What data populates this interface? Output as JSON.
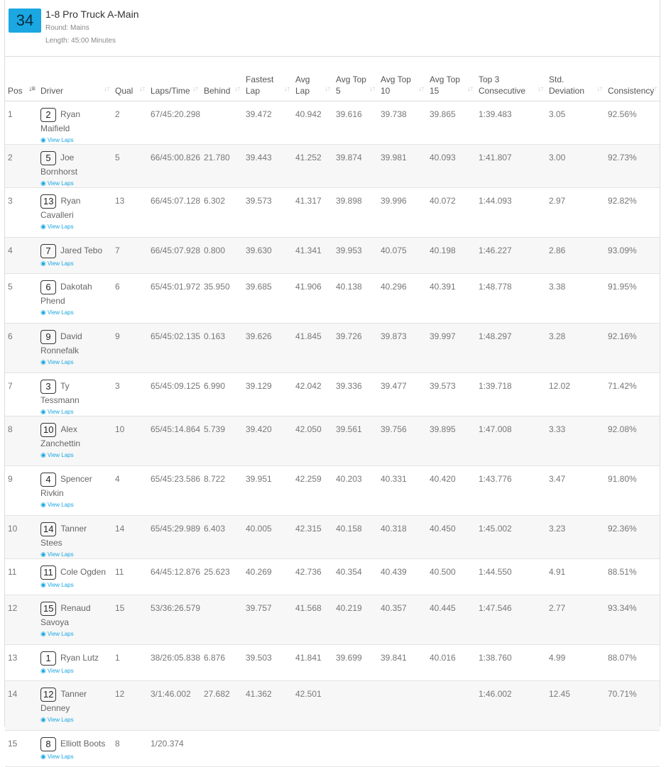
{
  "race": {
    "number": "34",
    "title": "1-8 Pro Truck A-Main",
    "round": "Round: Mains",
    "length": "Length: 45:00 Minutes"
  },
  "columns": {
    "pos": "Pos",
    "driver": "Driver",
    "qual": "Qual",
    "laps_time": "Laps/Time",
    "behind": "Behind",
    "fastest_lap_1": "Fastest",
    "fastest_lap_2": "Lap",
    "avg_lap_1": "Avg",
    "avg_lap_2": "Lap",
    "avg_top5_1": "Avg Top",
    "avg_top5_2": "5",
    "avg_top10_1": "Avg Top",
    "avg_top10_2": "10",
    "avg_top15_1": "Avg Top",
    "avg_top15_2": "15",
    "top3_1": "Top 3",
    "top3_2": "Consecutive",
    "std_1": "Std.",
    "std_2": "Deviation",
    "consistency": "Consistency"
  },
  "view_laps_label": "View Laps",
  "rows": [
    {
      "pos": "1",
      "car": "2",
      "name": "Ryan Maifield",
      "qual": "2",
      "laps_time": "67/45:20.298",
      "behind": "",
      "fastest": "39.472",
      "avg": "40.942",
      "top5": "39.616",
      "top10": "39.738",
      "top15": "39.865",
      "top3": "1:39.483",
      "std": "3.05",
      "consistency": "92.56%"
    },
    {
      "pos": "2",
      "car": "5",
      "name": "Joe Bornhorst",
      "qual": "5",
      "laps_time": "66/45:00.826",
      "behind": "21.780",
      "fastest": "39.443",
      "avg": "41.252",
      "top5": "39.874",
      "top10": "39.981",
      "top15": "40.093",
      "top3": "1:41.807",
      "std": "3.00",
      "consistency": "92.73%"
    },
    {
      "pos": "3",
      "car": "13",
      "name": "Ryan Cavalleri",
      "qual": "13",
      "laps_time": "66/45:07.128",
      "behind": "6.302",
      "fastest": "39.573",
      "avg": "41.317",
      "top5": "39.898",
      "top10": "39.996",
      "top15": "40.072",
      "top3": "1:44.093",
      "std": "2.97",
      "consistency": "92.82%"
    },
    {
      "pos": "4",
      "car": "7",
      "name": "Jared Tebo",
      "qual": "7",
      "laps_time": "66/45:07.928",
      "behind": "0.800",
      "fastest": "39.630",
      "avg": "41.341",
      "top5": "39.953",
      "top10": "40.075",
      "top15": "40.198",
      "top3": "1:46.227",
      "std": "2.86",
      "consistency": "93.09%"
    },
    {
      "pos": "5",
      "car": "6",
      "name": "Dakotah Phend",
      "qual": "6",
      "laps_time": "65/45:01.972",
      "behind": "35.950",
      "fastest": "39.685",
      "avg": "41.906",
      "top5": "40.138",
      "top10": "40.296",
      "top15": "40.391",
      "top3": "1:48.778",
      "std": "3.38",
      "consistency": "91.95%"
    },
    {
      "pos": "6",
      "car": "9",
      "name": "David Ronnefalk",
      "qual": "9",
      "laps_time": "65/45:02.135",
      "behind": "0.163",
      "fastest": "39.626",
      "avg": "41.845",
      "top5": "39.726",
      "top10": "39.873",
      "top15": "39.997",
      "top3": "1:48.297",
      "std": "3.28",
      "consistency": "92.16%"
    },
    {
      "pos": "7",
      "car": "3",
      "name": "Ty Tessmann",
      "qual": "3",
      "laps_time": "65/45:09.125",
      "behind": "6.990",
      "fastest": "39.129",
      "avg": "42.042",
      "top5": "39.336",
      "top10": "39.477",
      "top15": "39.573",
      "top3": "1:39.718",
      "std": "12.02",
      "consistency": "71.42%"
    },
    {
      "pos": "8",
      "car": "10",
      "name": "Alex Zanchettin",
      "qual": "10",
      "laps_time": "65/45:14.864",
      "behind": "5.739",
      "fastest": "39.420",
      "avg": "42.050",
      "top5": "39.561",
      "top10": "39.756",
      "top15": "39.895",
      "top3": "1:47.008",
      "std": "3.33",
      "consistency": "92.08%"
    },
    {
      "pos": "9",
      "car": "4",
      "name": "Spencer Rivkin",
      "qual": "4",
      "laps_time": "65/45:23.586",
      "behind": "8.722",
      "fastest": "39.951",
      "avg": "42.259",
      "top5": "40.203",
      "top10": "40.331",
      "top15": "40.420",
      "top3": "1:43.776",
      "std": "3.47",
      "consistency": "91.80%"
    },
    {
      "pos": "10",
      "car": "14",
      "name": "Tanner Stees",
      "qual": "14",
      "laps_time": "65/45:29.989",
      "behind": "6.403",
      "fastest": "40.005",
      "avg": "42.315",
      "top5": "40.158",
      "top10": "40.318",
      "top15": "40.450",
      "top3": "1:45.002",
      "std": "3.23",
      "consistency": "92.36%"
    },
    {
      "pos": "11",
      "car": "11",
      "name": "Cole Ogden",
      "qual": "11",
      "laps_time": "64/45:12.876",
      "behind": "25.623",
      "fastest": "40.269",
      "avg": "42.736",
      "top5": "40.354",
      "top10": "40.439",
      "top15": "40.500",
      "top3": "1:44.550",
      "std": "4.91",
      "consistency": "88.51%"
    },
    {
      "pos": "12",
      "car": "15",
      "name": "Renaud Savoya",
      "qual": "15",
      "laps_time": "53/36:26.579",
      "behind": "",
      "fastest": "39.757",
      "avg": "41.568",
      "top5": "40.219",
      "top10": "40.357",
      "top15": "40.445",
      "top3": "1:47.546",
      "std": "2.77",
      "consistency": "93.34%"
    },
    {
      "pos": "13",
      "car": "1",
      "name": "Ryan Lutz",
      "qual": "1",
      "laps_time": "38/26:05.838",
      "behind": "6.876",
      "fastest": "39.503",
      "avg": "41.841",
      "top5": "39.699",
      "top10": "39.841",
      "top15": "40.016",
      "top3": "1:38.760",
      "std": "4.99",
      "consistency": "88.07%"
    },
    {
      "pos": "14",
      "car": "12",
      "name": "Tanner Denney",
      "qual": "12",
      "laps_time": "3/1:46.002",
      "behind": "27.682",
      "fastest": "41.362",
      "avg": "42.501",
      "top5": "",
      "top10": "",
      "top15": "",
      "top3": "1:46.002",
      "std": "12.45",
      "consistency": "70.71%"
    },
    {
      "pos": "15",
      "car": "8",
      "name": "Elliott Boots",
      "qual": "8",
      "laps_time": "1/20.374",
      "behind": "",
      "fastest": "",
      "avg": "",
      "top5": "",
      "top10": "",
      "top15": "",
      "top3": "",
      "std": "",
      "consistency": ""
    }
  ]
}
